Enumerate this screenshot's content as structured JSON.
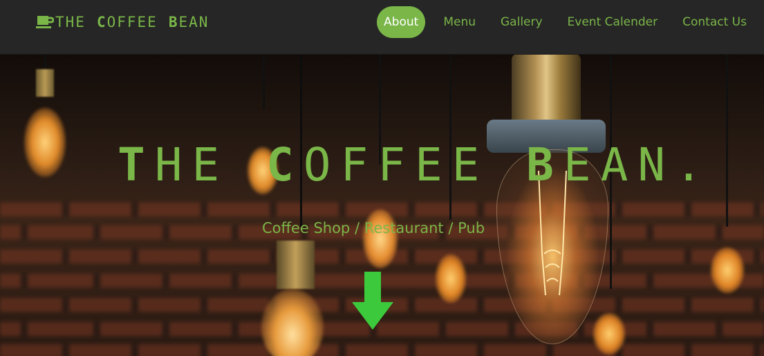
{
  "brand": {
    "words": [
      {
        "initial": "",
        "rest": "THE"
      },
      {
        "initial": "C",
        "rest": "OFFEE"
      },
      {
        "initial": "B",
        "rest": "EAN"
      }
    ],
    "accent_color": "#7ab648"
  },
  "nav": {
    "items": [
      {
        "label": "About",
        "active": true
      },
      {
        "label": "Menu",
        "active": false
      },
      {
        "label": "Gallery",
        "active": false
      },
      {
        "label": "Event Calender",
        "active": false
      },
      {
        "label": "Contact Us",
        "active": false
      }
    ]
  },
  "hero": {
    "title_parts": [
      {
        "initial": "T",
        "rest": "HE"
      },
      {
        "initial": "C",
        "rest": "OFFEE"
      },
      {
        "initial": "B",
        "rest": "EAN."
      }
    ],
    "subtitle": "Coffee Shop / Restaurant / Pub",
    "arrow_icon": "arrow-down-icon",
    "arrow_color": "#3cc93c"
  }
}
